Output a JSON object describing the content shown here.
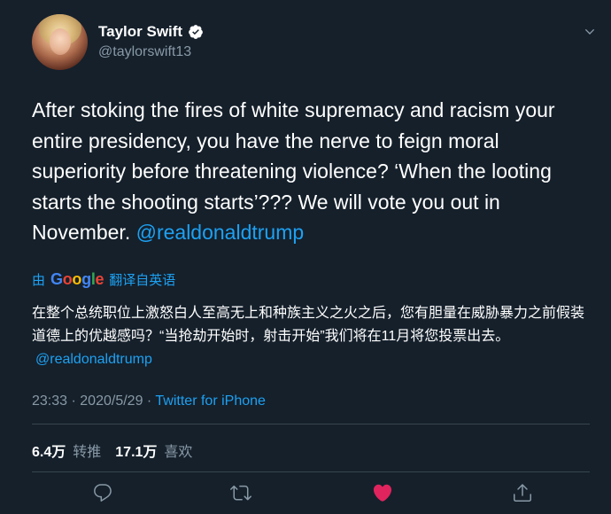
{
  "user": {
    "name": "Taylor Swift",
    "handle": "@taylorswift13",
    "verified_icon": "verified-badge-icon"
  },
  "tweet": {
    "text_plain": "After stoking the fires of white supremacy and racism your entire presidency, you have the nerve to feign moral superiority before threatening violence? ‘When the looting starts the shooting starts’??? We will vote you out in November.",
    "mention": "@realdonaldtrump"
  },
  "translate": {
    "prefix": "由",
    "google": [
      "G",
      "o",
      "o",
      "g",
      "l",
      "e"
    ],
    "suffix": "翻译自英语"
  },
  "translation": {
    "text": "在整个总统职位上激怒白人至高无上和种族主义之火之后，您有胆量在威胁暴力之前假装道德上的优越感吗？“当抢劫开始时，射击开始”我们将在11月将您投票出去。",
    "mention": "@realdonaldtrump"
  },
  "meta": {
    "time": "23:33",
    "date": "2020/5/29",
    "separator": "·",
    "source": "Twitter for iPhone"
  },
  "stats": {
    "retweets_count": "6.4万",
    "retweets_label": "转推",
    "likes_count": "17.1万",
    "likes_label": "喜欢"
  },
  "colors": {
    "background": "#15202b",
    "link": "#1da1f2",
    "muted": "#8899a6",
    "like": "#e0245e"
  }
}
